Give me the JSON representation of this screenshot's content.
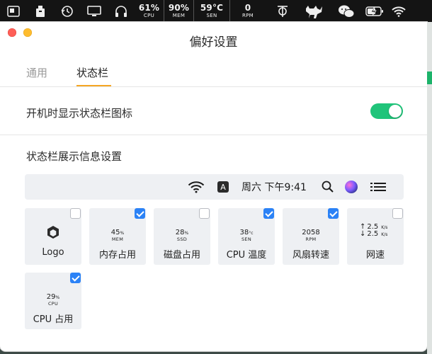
{
  "menubar": {
    "icons": [
      "screen-icon",
      "archive-icon",
      "time-machine-icon",
      "display-icon",
      "headphones-icon",
      "stats-icon",
      "cat-icon",
      "wechat-icon",
      "battery-icon",
      "wifi-icon"
    ],
    "cpu": {
      "value": "61%",
      "unit": "CPU"
    },
    "mem": {
      "value": "90%",
      "unit": "MEM"
    },
    "sen": {
      "value": "59°C",
      "unit": "SEN"
    },
    "rpm": {
      "value": "0",
      "unit": "RPM"
    }
  },
  "window": {
    "title": "偏好设置",
    "tabs": [
      {
        "label": "通用"
      },
      {
        "label": "状态栏"
      }
    ],
    "active_tab": "状态栏",
    "toggle_row": {
      "label": "开机时显示状态栏图标",
      "enabled": true
    },
    "section_title": "状态栏展示信息设置",
    "preview": {
      "input_source": "A",
      "clock": "周六 下午9:41"
    },
    "tiles": [
      {
        "name": "Logo",
        "checked": false
      },
      {
        "name": "内存占用",
        "checked": true,
        "value": "45",
        "pct": "%",
        "sub": "MEM"
      },
      {
        "name": "磁盘占用",
        "checked": false,
        "value": "28",
        "pct": "%",
        "sub": "SSD"
      },
      {
        "name": "CPU 温度",
        "checked": true,
        "value": "38",
        "pct": "°c",
        "sub": "SEN"
      },
      {
        "name": "风扇转速",
        "checked": true,
        "value": "2058",
        "pct": "",
        "sub": "RPM"
      },
      {
        "name": "网速",
        "checked": false,
        "up": "2.5",
        "down": "2.5",
        "unit": "K/s"
      },
      {
        "name": "CPU 占用",
        "checked": true,
        "value": "29",
        "pct": "%",
        "sub": "CPU"
      }
    ]
  },
  "colors": {
    "toggle_on": "#20c47a",
    "tab_accent": "#f5a623",
    "checkbox_on": "#2b82f6",
    "close": "#fe5f57",
    "minimize": "#febc2e"
  }
}
